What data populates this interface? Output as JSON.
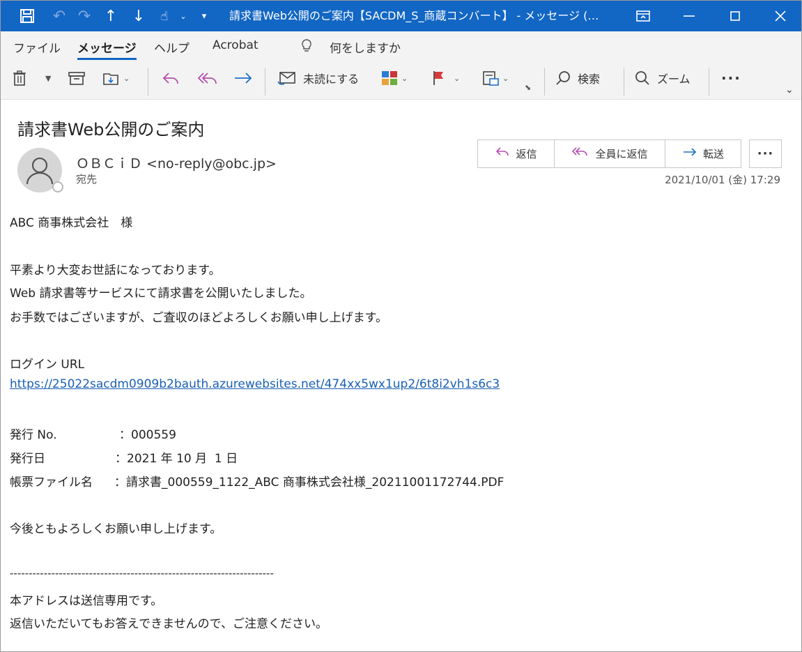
{
  "window": {
    "title": "請求書Web公開のご案内【SACDM_S_商蔵コンバート】 - メッセージ (…"
  },
  "menu": {
    "tabs": [
      "ファイル",
      "メッセージ",
      "ヘルプ",
      "Acrobat"
    ],
    "active_tab": "メッセージ",
    "search_hint": "何をしますか"
  },
  "toolbar": {
    "mark_unread": "未読にする",
    "search": "検索",
    "zoom": "ズーム"
  },
  "message": {
    "subject": "請求書Web公開のご案内",
    "sender": "ＯＢＣｉＤ <no-reply@obc.jp>",
    "to_label": "宛先",
    "date": "2021/10/01 (金) 17:29",
    "actions": {
      "reply": "返信",
      "reply_all": "全員に返信",
      "forward": "転送"
    }
  },
  "body": {
    "salutation": "ABC 商事株式会社　様",
    "p1": "平素より大変お世話になっております。",
    "p2": "Web 請求書等サービスにて請求書を公開いたしました。",
    "p3": "お手数ではございますが、ご査収のほどよろしくお願い申し上げます。",
    "login_label": "ログイン URL",
    "login_url": "https://25022sacdm0909b2bauth.azurewebsites.net/474xx5wx1up2/6t8i2vh1s6c3",
    "issue_no_label": "発行 No.",
    "issue_no": "：000559",
    "issue_date_label": "発行日",
    "issue_date": "：2021 年 10 月  1 日",
    "file_label": "帳票ファイル名",
    "file_name": "：請求書_000559_1122_ABC 商事株式会社様_20211001172744.PDF",
    "closing": "今後ともよろしくお願い申し上げます。",
    "divider": "----------------------------------------------------------------------",
    "note1": "本アドレスは送信専用です。",
    "note2": "返信いただいてもお答えできませんので、ご注意ください。"
  },
  "colors": {
    "titlebar": "#1266c4",
    "link": "#1a5fb4",
    "flag": "#d83b3b"
  }
}
